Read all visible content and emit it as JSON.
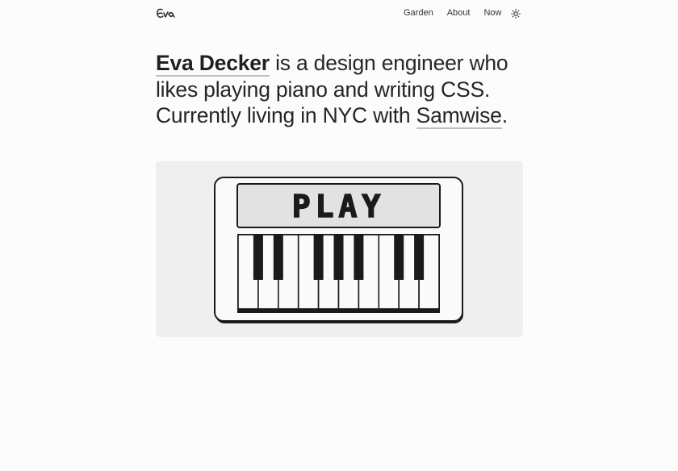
{
  "header": {
    "logo_icon": "eva-signature-logo",
    "nav": [
      {
        "label": "Garden"
      },
      {
        "label": "About"
      },
      {
        "label": "Now"
      }
    ],
    "theme_toggle_icon": "sun-icon"
  },
  "intro": {
    "name": "Eva Decker",
    "part1": " is a design engineer who likes playing piano and writing CSS. Currently living in NYC with ",
    "dog": "Samwise",
    "end": "."
  },
  "piano": {
    "screen_text": "PLAY",
    "white_keys": 10,
    "colors": {
      "card_bg": "#efefef",
      "screen_bg": "#e2e2e2",
      "outline": "#1a1a1a"
    }
  }
}
